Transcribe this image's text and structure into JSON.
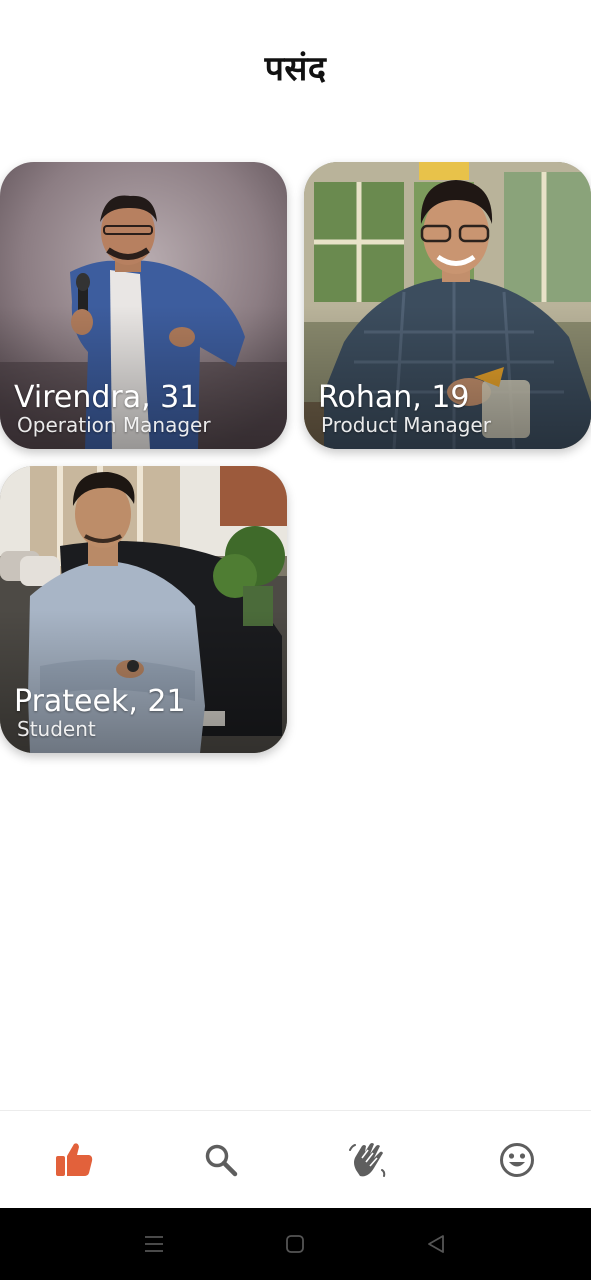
{
  "header": {
    "title": "पसंद"
  },
  "cards": [
    {
      "name": "Virendra, 31",
      "role": "Operation Manager"
    },
    {
      "name": "Rohan, 19",
      "role": "Product Manager"
    },
    {
      "name": "Prateek, 21",
      "role": "Student"
    }
  ],
  "bottom_nav": {
    "items": [
      {
        "icon": "thumbs-up-icon",
        "active": true
      },
      {
        "icon": "search-icon",
        "active": false
      },
      {
        "icon": "waving-hand-icon",
        "active": false
      },
      {
        "icon": "smiley-face-icon",
        "active": false
      }
    ],
    "active_color": "#e2613b",
    "inactive_color": "#5e5e5e"
  },
  "system_nav": {
    "buttons": [
      "menu-icon",
      "home-icon",
      "back-icon"
    ]
  }
}
